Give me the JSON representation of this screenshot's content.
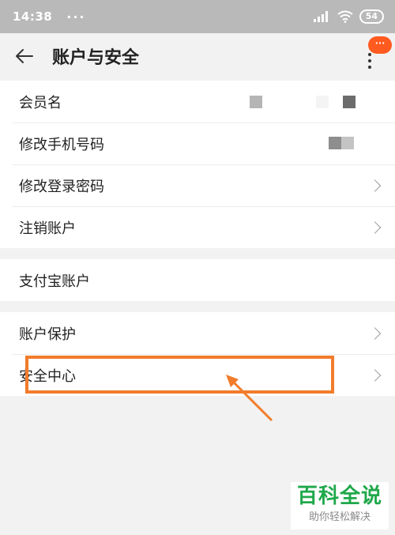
{
  "status_bar": {
    "time": "14:38",
    "dots": "···",
    "battery": "54"
  },
  "header": {
    "title": "账户与安全",
    "badge": "···"
  },
  "group1": [
    {
      "label": "会员名",
      "chevron": false
    },
    {
      "label": "修改手机号码",
      "chevron": false
    },
    {
      "label": "修改登录密码",
      "chevron": true
    },
    {
      "label": "注销账户",
      "chevron": true
    }
  ],
  "group2": [
    {
      "label": "支付宝账户",
      "chevron": false
    }
  ],
  "group3": [
    {
      "label": "账户保护",
      "chevron": true
    },
    {
      "label": "安全中心",
      "chevron": true
    }
  ],
  "watermark": {
    "title": "百科全说",
    "subtitle": "助你轻松解决"
  },
  "colors": {
    "accent": "#f27c2c",
    "badge": "#ff5a1f",
    "watermark": "#1fa84a"
  }
}
